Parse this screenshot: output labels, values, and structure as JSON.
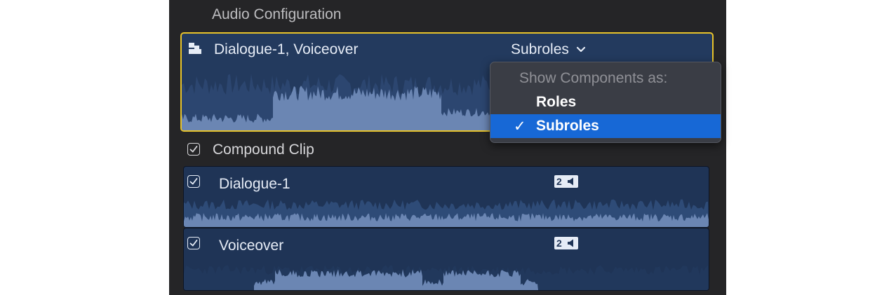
{
  "panel": {
    "title": "Audio Configuration"
  },
  "main_clip": {
    "label": "Dialogue-1, Voiceover",
    "subroles_button": "Subroles"
  },
  "menu": {
    "header": "Show Components as:",
    "items": [
      {
        "label": "Roles",
        "checked": false,
        "highlighted": false
      },
      {
        "label": "Subroles",
        "checked": true,
        "highlighted": true
      }
    ],
    "check_glyph": "✓"
  },
  "compound": {
    "label": "Compound Clip",
    "checked": true
  },
  "components": [
    {
      "label": "Dialogue-1",
      "checked": true,
      "channels": "2",
      "icon": "speaker-icon"
    },
    {
      "label": "Voiceover",
      "checked": true,
      "channels": "2",
      "icon": "speaker-icon"
    }
  ],
  "colors": {
    "panel_bg": "#252527",
    "clip_bg": "#1f3456",
    "selection_border": "#e8c32a",
    "waveform": "#6b86b3",
    "menu_highlight": "#1768d6"
  }
}
